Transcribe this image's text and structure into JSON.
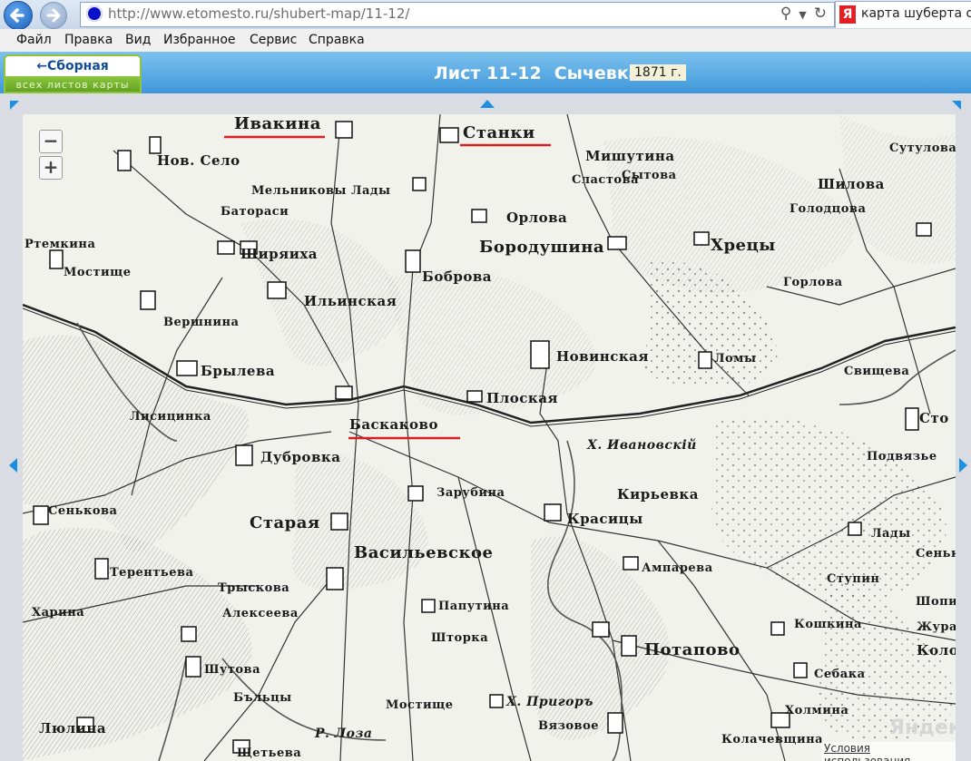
{
  "browser": {
    "url": "http://www.etomesto.ru/shubert-map/11-12/",
    "tab_title": "карта шуберта он",
    "tab_icon": "Я"
  },
  "menu": [
    "Файл",
    "Правка",
    "Вид",
    "Избранное",
    "Сервис",
    "Справка"
  ],
  "header": {
    "index_button": "←Сборная таблица",
    "index_sub": "всех листов карты",
    "sheet": "Лист 11-12",
    "sheet_name": "Сычевка",
    "year": "1871 г."
  },
  "map": {
    "zoom_out": "−",
    "zoom_in": "+",
    "provider_logo": "Яндекс",
    "terms_link": "Условия использования",
    "underline_color": "#d42020",
    "places": [
      {
        "name": "Ивакина",
        "cls": "big"
      },
      {
        "name": "Станки",
        "cls": "big"
      },
      {
        "name": "Нов. Село",
        "cls": ""
      },
      {
        "name": "Мельниковы Лады",
        "cls": "sm"
      },
      {
        "name": "Мишутина",
        "cls": ""
      },
      {
        "name": "Сытова",
        "cls": "sm"
      },
      {
        "name": "Сутулова",
        "cls": "sm"
      },
      {
        "name": "Шилова",
        "cls": ""
      },
      {
        "name": "Сластова",
        "cls": "sm"
      },
      {
        "name": "Голодцова",
        "cls": "sm"
      },
      {
        "name": "Батораси",
        "cls": "sm"
      },
      {
        "name": "Орлова",
        "cls": ""
      },
      {
        "name": "Ртемкина",
        "cls": "sm"
      },
      {
        "name": "Бородушина",
        "cls": "big"
      },
      {
        "name": "Хрецы",
        "cls": "big"
      },
      {
        "name": "Ширяиха",
        "cls": ""
      },
      {
        "name": "Мостище",
        "cls": "sm"
      },
      {
        "name": "Боброва",
        "cls": ""
      },
      {
        "name": "Горлова",
        "cls": "sm"
      },
      {
        "name": "Ильинская",
        "cls": ""
      },
      {
        "name": "Вершнина",
        "cls": "sm"
      },
      {
        "name": "Новинская",
        "cls": ""
      },
      {
        "name": "Ломы",
        "cls": "sm"
      },
      {
        "name": "Брылева",
        "cls": ""
      },
      {
        "name": "Свищева",
        "cls": "sm"
      },
      {
        "name": "Плоская",
        "cls": ""
      },
      {
        "name": "Лисицинка",
        "cls": "sm"
      },
      {
        "name": "Баскаково",
        "cls": ""
      },
      {
        "name": "Сто",
        "cls": ""
      },
      {
        "name": "Х. Ивановскій",
        "cls": "it"
      },
      {
        "name": "Дубровка",
        "cls": ""
      },
      {
        "name": "Подвязье",
        "cls": "sm"
      },
      {
        "name": "Зарубина",
        "cls": "sm"
      },
      {
        "name": "Кирьевка",
        "cls": ""
      },
      {
        "name": "Сенькова",
        "cls": "sm"
      },
      {
        "name": "Старая",
        "cls": "big"
      },
      {
        "name": "Красицы",
        "cls": ""
      },
      {
        "name": "Лады",
        "cls": "sm"
      },
      {
        "name": "Васильевское",
        "cls": "big"
      },
      {
        "name": "Сеньк",
        "cls": "sm"
      },
      {
        "name": "Терентьева",
        "cls": "sm"
      },
      {
        "name": "Ампарева",
        "cls": "sm"
      },
      {
        "name": "Ступин",
        "cls": "sm"
      },
      {
        "name": "Трыскова",
        "cls": "sm"
      },
      {
        "name": "Шопин",
        "cls": "sm"
      },
      {
        "name": "Харина",
        "cls": "sm"
      },
      {
        "name": "Алексеева",
        "cls": "sm"
      },
      {
        "name": "Папутина",
        "cls": "sm"
      },
      {
        "name": "Кошкина",
        "cls": "sm"
      },
      {
        "name": "Журав",
        "cls": "sm"
      },
      {
        "name": "Шторка",
        "cls": "sm"
      },
      {
        "name": "Потапово",
        "cls": "big"
      },
      {
        "name": "Колоко",
        "cls": ""
      },
      {
        "name": "Шутова",
        "cls": "sm"
      },
      {
        "name": "Себака",
        "cls": "sm"
      },
      {
        "name": "Бъльцы",
        "cls": "sm"
      },
      {
        "name": "Х. Пригоръ",
        "cls": "it"
      },
      {
        "name": "Холмина",
        "cls": "sm"
      },
      {
        "name": "Мостище",
        "cls": "sm"
      },
      {
        "name": "Вязовое",
        "cls": "sm"
      },
      {
        "name": "Люлина",
        "cls": ""
      },
      {
        "name": "Р. Лоза",
        "cls": "it"
      },
      {
        "name": "Колачевщина",
        "cls": "sm"
      },
      {
        "name": "Щетьева",
        "cls": "sm"
      }
    ]
  }
}
